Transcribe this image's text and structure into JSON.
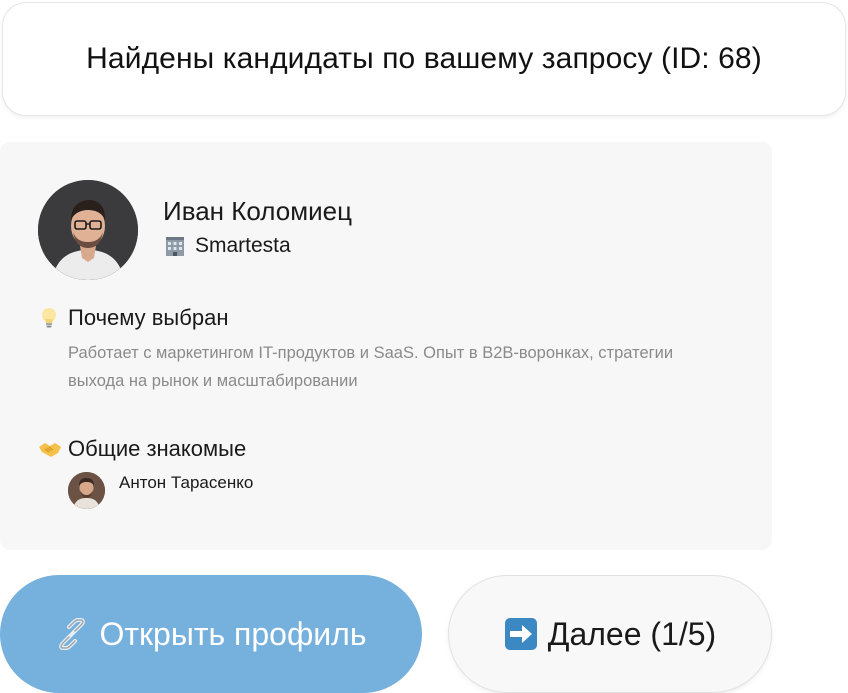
{
  "header": {
    "text": "Найдены кандидаты по вашему запросу (ID: 68)"
  },
  "candidate": {
    "name": "Иван Коломиец",
    "company": "Smartesta",
    "company_icon": "office-building-icon",
    "why": {
      "icon": "lightbulb-icon",
      "title": "Почему выбран",
      "text": "Работает с маркетингом IT-продуктов и SaaS. Опыт в B2B-воронках, стратегии выхода на рынок и масштабировании"
    },
    "common": {
      "icon": "handshake-icon",
      "title": "Общие знакомые",
      "friends": [
        {
          "name": "Антон Тарасенко"
        }
      ]
    }
  },
  "buttons": {
    "open": {
      "icon": "link-icon",
      "label": "Открыть профиль",
      "color": "#76b0dc"
    },
    "next": {
      "icon": "right-arrow-icon",
      "label": "Далее (1/5)"
    }
  }
}
